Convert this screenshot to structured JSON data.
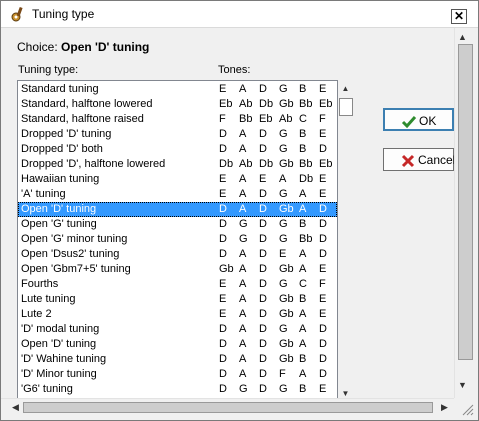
{
  "window": {
    "title": "Tuning type"
  },
  "choice": {
    "label": "Choice:",
    "value": "Open 'D' tuning"
  },
  "labels": {
    "tuning_type": "Tuning type:",
    "tones": "Tones:"
  },
  "buttons": {
    "ok": "OK",
    "cancel": "Cancel"
  },
  "icons": {
    "app": "banjo-icon",
    "close": "close-icon",
    "ok": "checkmark-icon",
    "cancel": "x-icon"
  },
  "colors": {
    "selection": "#3399ff",
    "ok_check": "#2e8b2e",
    "cancel_x": "#c62828"
  },
  "tunings": [
    {
      "name": "Standard tuning",
      "tones": [
        "E",
        "A",
        "D",
        "G",
        "B",
        "E"
      ]
    },
    {
      "name": "Standard, halftone lowered",
      "tones": [
        "Eb",
        "Ab",
        "Db",
        "Gb",
        "Bb",
        "Eb"
      ]
    },
    {
      "name": "Standard, halftone raised",
      "tones": [
        "F",
        "Bb",
        "Eb",
        "Ab",
        "C",
        "F"
      ]
    },
    {
      "name": "Dropped 'D' tuning",
      "tones": [
        "D",
        "A",
        "D",
        "G",
        "B",
        "E"
      ]
    },
    {
      "name": "Dropped 'D' both",
      "tones": [
        "D",
        "A",
        "D",
        "G",
        "B",
        "D"
      ]
    },
    {
      "name": "Dropped 'D', halftone lowered",
      "tones": [
        "Db",
        "Ab",
        "Db",
        "Gb",
        "Bb",
        "Eb"
      ]
    },
    {
      "name": "Hawaiian tuning",
      "tones": [
        "E",
        "A",
        "E",
        "A",
        "Db",
        "E"
      ]
    },
    {
      "name": "'A' tuning",
      "tones": [
        "E",
        "A",
        "D",
        "G",
        "A",
        "E"
      ]
    },
    {
      "name": "Open 'D' tuning",
      "tones": [
        "D",
        "A",
        "D",
        "Gb",
        "A",
        "D"
      ],
      "selected": true
    },
    {
      "name": "Open 'G' tuning",
      "tones": [
        "D",
        "G",
        "D",
        "G",
        "B",
        "D"
      ]
    },
    {
      "name": "Open 'G' minor tuning",
      "tones": [
        "D",
        "G",
        "D",
        "G",
        "Bb",
        "D"
      ]
    },
    {
      "name": "Open 'Dsus2' tuning",
      "tones": [
        "D",
        "A",
        "D",
        "E",
        "A",
        "D"
      ]
    },
    {
      "name": "Open 'Gbm7+5' tuning",
      "tones": [
        "Gb",
        "A",
        "D",
        "Gb",
        "A",
        "E"
      ]
    },
    {
      "name": "Fourths",
      "tones": [
        "E",
        "A",
        "D",
        "G",
        "C",
        "F"
      ]
    },
    {
      "name": "Lute tuning",
      "tones": [
        "E",
        "A",
        "D",
        "Gb",
        "B",
        "E"
      ]
    },
    {
      "name": "Lute 2",
      "tones": [
        "E",
        "A",
        "D",
        "Gb",
        "A",
        "E"
      ]
    },
    {
      "name": "'D' modal tuning",
      "tones": [
        "D",
        "A",
        "D",
        "G",
        "A",
        "D"
      ]
    },
    {
      "name": "Open 'D' tuning",
      "tones": [
        "D",
        "A",
        "D",
        "Gb",
        "A",
        "D"
      ]
    },
    {
      "name": "'D' Wahine tuning",
      "tones": [
        "D",
        "A",
        "D",
        "Gb",
        "B",
        "D"
      ]
    },
    {
      "name": "'D' Minor tuning",
      "tones": [
        "D",
        "A",
        "D",
        "F",
        "A",
        "D"
      ]
    },
    {
      "name": "'G6' tuning",
      "tones": [
        "D",
        "G",
        "D",
        "G",
        "B",
        "E"
      ]
    }
  ]
}
